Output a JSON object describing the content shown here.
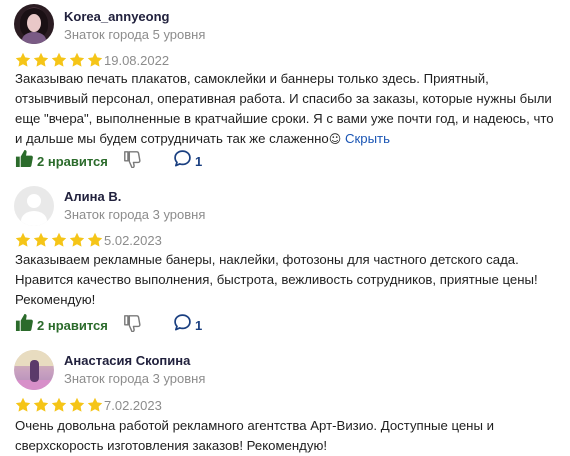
{
  "reviews": [
    {
      "author": "Korea_annyeong",
      "level": "Знаток города 5 уровня",
      "rating": 5,
      "date": "19.08.2022",
      "text": "Заказываю печать плакатов, самоклейки и баннеры только здесь. Приятный, отзывчивый персонал, оперативная работа. И спасибо за заказы, которые нужны были еще \"вчера\", выполненные в кратчайшие сроки. Я с вами уже почти год, и надеюсь, что и дальше мы будем сотрудничать так же слаженно",
      "emoji": "☺",
      "collapse_label": "Скрыть",
      "likes_label": "2 нравится",
      "comments": "1"
    },
    {
      "author": "Алина В.",
      "level": "Знаток города 3 уровня",
      "rating": 5,
      "date": "5.02.2023",
      "text": "Заказываем рекламные банеры, наклейки, фотозоны для частного детского сада. Нравится качество выполнения, быстрота, вежливость сотрудников, приятные цены! Рекомендую!",
      "likes_label": "2 нравится",
      "comments": "1"
    },
    {
      "author": "Анастасия Скопина",
      "level": "Знаток города 3 уровня",
      "rating": 5,
      "date": "7.02.2023",
      "text": "Очень довольна работой рекламного агентства Арт-Визио. Доступные цены и сверхскорость изготовления заказов! Рекомендую!"
    }
  ],
  "colors": {
    "star": "#f5c518",
    "like_green": "#2b6b2b",
    "comment_blue": "#1a3f80",
    "muted": "#8c8c8c",
    "link": "#1a55b4"
  }
}
